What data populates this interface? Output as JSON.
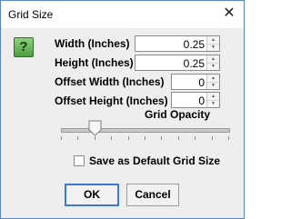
{
  "window": {
    "title": "Grid Size",
    "close_glyph": "✕"
  },
  "help_icon": {
    "glyph": "?",
    "color": "#5faf4c"
  },
  "fields": [
    {
      "label": "Width (Inches)",
      "value": "0.25"
    },
    {
      "label": "Height (Inches)",
      "value": "0.25"
    },
    {
      "label": "Offset Width (Inches)",
      "value": "0"
    },
    {
      "label": "Offset Height (Inches)",
      "value": "0"
    }
  ],
  "grid_opacity": {
    "label": "Grid Opacity",
    "value_fraction": 0.2
  },
  "checkbox": {
    "label": "Save as Default Grid Size",
    "checked": false
  },
  "buttons": {
    "ok": "OK",
    "cancel": "Cancel"
  },
  "colors": {
    "accent": "#3b7ad6",
    "window_border": "#5a86c8"
  }
}
